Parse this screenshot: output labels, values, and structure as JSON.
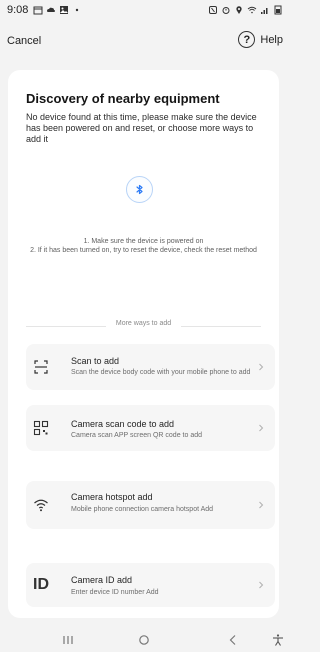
{
  "status_bar": {
    "time": "9:08",
    "left_icons": [
      "calendar-icon",
      "cloud-icon",
      "photo-icon",
      "dot-icon"
    ],
    "right_icons": [
      "nfc-icon",
      "alarm-icon",
      "location-icon",
      "wifi-icon",
      "signal-icon",
      "battery-icon"
    ]
  },
  "top_bar": {
    "cancel_label": "Cancel",
    "help_label": "Help"
  },
  "discovery": {
    "title": "Discovery of nearby equipment",
    "description": "No device found at this time, please make sure the device has been powered on and reset, or choose more ways to add it",
    "hint_line_1": "1. Make sure the device is powered on",
    "hint_line_2": "2. If it has been turned on, try to reset the device, check the reset method",
    "more_ways_label": "More ways to add"
  },
  "options": [
    {
      "title": "Scan to add",
      "subtitle": "Scan the device body code with your mobile phone to add",
      "icon": "scan-icon"
    },
    {
      "title": "Camera scan code to add",
      "subtitle": "Camera scan APP screen QR code to add",
      "icon": "qr-code-icon"
    },
    {
      "title": "Camera hotspot add",
      "subtitle": "Mobile phone connection camera hotspot Add",
      "icon": "wifi-icon"
    },
    {
      "title": "Camera ID add",
      "subtitle": "Enter device ID number Add",
      "icon": "id-icon",
      "icon_text": "ID"
    }
  ],
  "nav_bar": {
    "items": [
      "recent-apps-icon",
      "home-icon",
      "back-icon",
      "accessibility-icon"
    ]
  },
  "colors": {
    "background": "#f3f3f3",
    "sheet": "#ffffff",
    "card": "#f6f6f6",
    "accent": "#2f7df6"
  }
}
